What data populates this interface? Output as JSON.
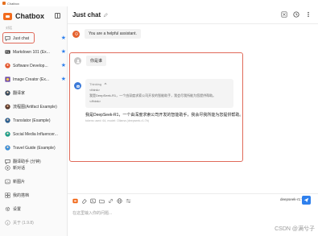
{
  "window": {
    "title": "Chatbox"
  },
  "sidebar": {
    "brand": "Chatbox",
    "section_label": "对话",
    "conversations": [
      {
        "label": "Just chat",
        "icon": "chat-bubble-icon",
        "starred": true,
        "active": true
      },
      {
        "label": "Markdown 101 (Ex...",
        "icon": "markdown-icon",
        "starred": true
      },
      {
        "label": "Software Develop...",
        "icon": "software-dev-avatar-icon",
        "starred": true
      },
      {
        "label": "Image Creator (Ex...",
        "icon": "image-creator-avatar-icon",
        "starred": true
      },
      {
        "label": "翻译家",
        "icon": "translator-avatar-icon",
        "starred": false
      },
      {
        "label": "流程图(Artifact Example)",
        "icon": "flowchart-avatar-icon",
        "starred": false
      },
      {
        "label": "Translator (Example)",
        "icon": "translator-avatar-icon",
        "starred": false
      },
      {
        "label": "Social Media Influencer...",
        "icon": "social-media-avatar-icon",
        "starred": false
      },
      {
        "label": "Travel Guide (Example)",
        "icon": "travel-guide-avatar-icon",
        "starred": false
      },
      {
        "label": "翻译助手 (分钟)",
        "icon": "chat-bubble-icon",
        "starred": false
      }
    ],
    "bottom_items": [
      {
        "label": "新对话",
        "icon": "plus-icon"
      },
      {
        "label": "新图片",
        "icon": "image-icon"
      },
      {
        "label": "我的搭档",
        "icon": "partner-icon"
      },
      {
        "label": "设置",
        "icon": "gear-icon"
      },
      {
        "label": "关于 (1.9.8)",
        "icon": "info-icon"
      }
    ]
  },
  "header": {
    "title": "Just chat"
  },
  "messages": {
    "system": "You are a helpful assistant.",
    "user": "你是谁",
    "thinking": {
      "label": "Thinking",
      "lines": [
        "<think>",
        "我是DeepSeek-R1，一个由深度求索公司开发的智能助手，我会尽我所能为您提供帮助。",
        "</think>"
      ]
    },
    "answer": "我是DeepSeek-R1，一个由深度求索公司开发的智能助手，我会尽我所能为您提供帮助。",
    "meta": "tokens used: 64, model: Ollama (deepseek-r1:7b)"
  },
  "input": {
    "model": "deepseek-r1:7b",
    "placeholder": "在这里输入你的问题..."
  },
  "watermark": "CSDN @满兮子",
  "colors": {
    "accent": "#2f80ed",
    "brand": "#f26b1d",
    "highlight": "#e06a5a"
  }
}
